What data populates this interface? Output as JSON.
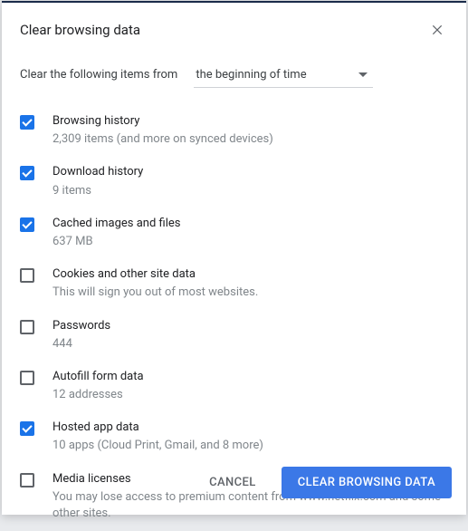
{
  "dialog": {
    "title": "Clear browsing data",
    "prompt": "Clear the following items from",
    "range_selected": "the beginning of time"
  },
  "items": [
    {
      "title": "Browsing history",
      "sub": "2,309 items (and more on synced devices)",
      "checked": true
    },
    {
      "title": "Download history",
      "sub": "9 items",
      "checked": true
    },
    {
      "title": "Cached images and files",
      "sub": "637 MB",
      "checked": true
    },
    {
      "title": "Cookies and other site data",
      "sub": "This will sign you out of most websites.",
      "checked": false
    },
    {
      "title": "Passwords",
      "sub": "444",
      "checked": false
    },
    {
      "title": "Autofill form data",
      "sub": "12 addresses",
      "checked": false
    },
    {
      "title": "Hosted app data",
      "sub": "10 apps (Cloud Print, Gmail, and 8 more)",
      "checked": true
    },
    {
      "title": "Media licenses",
      "sub": "You may lose access to premium content from www.netflix.com and some other sites.",
      "checked": false
    }
  ],
  "buttons": {
    "cancel": "CANCEL",
    "confirm": "CLEAR BROWSING DATA"
  }
}
